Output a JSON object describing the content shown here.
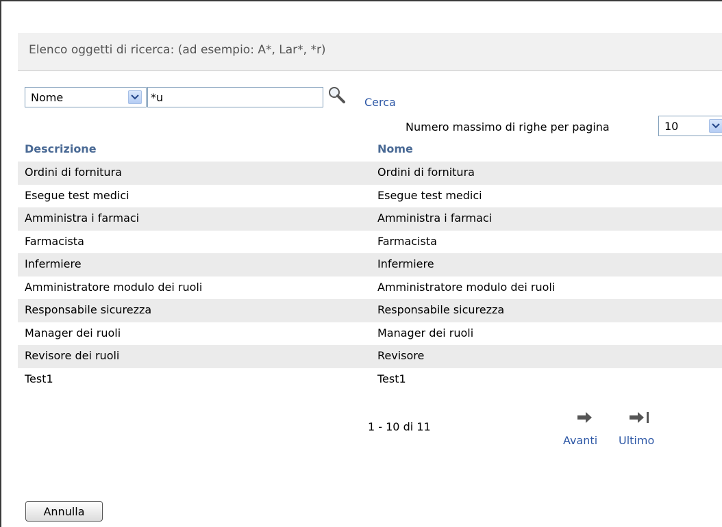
{
  "header": {
    "title": "Elenco oggetti di ricerca: (ad esempio: A*, Lar*, *r)"
  },
  "search": {
    "field_select_value": "Nome",
    "query_value": "*u",
    "search_link_label": "Cerca"
  },
  "paging_options": {
    "label": "Numero massimo di righe per pagina",
    "selected_value": "10"
  },
  "table": {
    "columns": [
      "Descrizione",
      "Nome"
    ],
    "rows": [
      [
        "Ordini di fornitura",
        "Ordini di fornitura"
      ],
      [
        "Esegue test medici",
        "Esegue test medici"
      ],
      [
        "Amministra i farmaci",
        "Amministra i farmaci"
      ],
      [
        "Farmacista",
        "Farmacista"
      ],
      [
        "Infermiere",
        "Infermiere"
      ],
      [
        "Amministratore modulo dei ruoli",
        "Amministratore modulo dei ruoli"
      ],
      [
        "Responsabile sicurezza",
        "Responsabile sicurezza"
      ],
      [
        "Manager dei ruoli",
        "Manager dei ruoli"
      ],
      [
        "Revisore dei ruoli",
        "Revisore"
      ],
      [
        "Test1",
        "Test1"
      ]
    ]
  },
  "pagination": {
    "range_text": "1 - 10 di 11",
    "next_label": "Avanti",
    "last_label": "Ultimo"
  },
  "actions": {
    "cancel_label": "Annulla"
  },
  "icons": {
    "search": "magnifier-icon",
    "dropdown": "chevron-down-icon",
    "next": "arrow-right-icon",
    "last": "arrow-right-bar-icon"
  },
  "colors": {
    "link": "#2e58a6",
    "column_header": "#4a6a95",
    "row_shade": "#ebebeb",
    "header_bg": "#f1f1f1"
  }
}
